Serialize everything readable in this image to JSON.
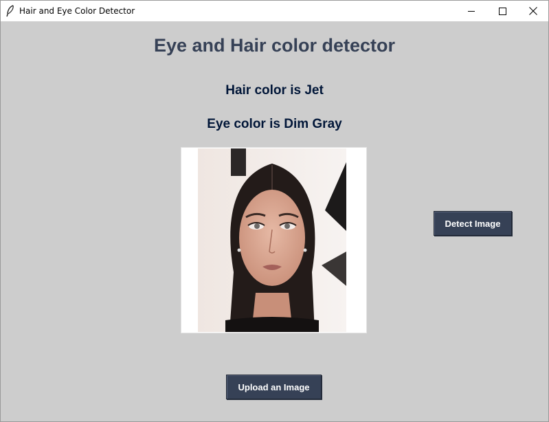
{
  "window": {
    "title": "Hair and Eye Color Detector",
    "icon": "feather-icon",
    "controls": [
      "minimize-icon",
      "maximize-icon",
      "close-icon"
    ]
  },
  "main": {
    "heading": "Eye and Hair color detector",
    "hair_result": "Hair color is Jet",
    "eye_result": "Eye color is Dim Gray"
  },
  "buttons": {
    "detect_label": "Detect Image",
    "upload_label": "Upload an Image"
  },
  "colors": {
    "background": "#cdcdcd",
    "heading": "#364156",
    "result_text": "#011638",
    "button_bg": "#364156",
    "button_text": "#ffffff"
  }
}
